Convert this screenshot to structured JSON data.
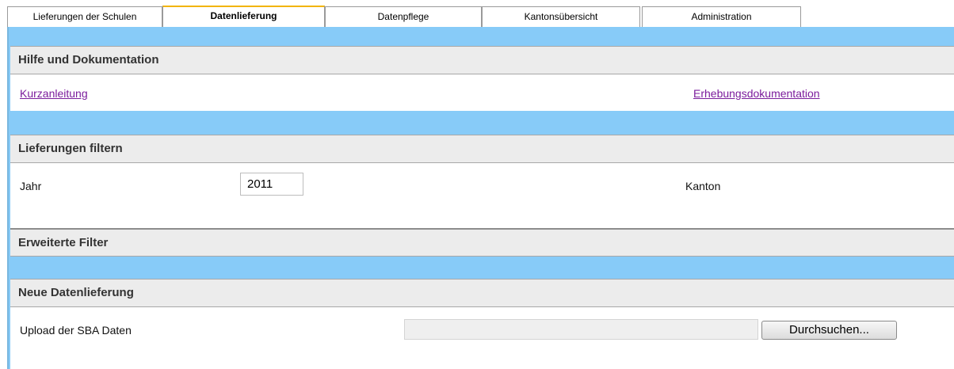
{
  "tabs": [
    {
      "label": "Lieferungen der Schulen",
      "active": false
    },
    {
      "label": "Datenlieferung",
      "active": true
    },
    {
      "label": "Datenpflege",
      "active": false
    },
    {
      "label": "Kantonsübersicht",
      "active": false
    },
    {
      "label": "Administration",
      "active": false
    }
  ],
  "help": {
    "title": "Hilfe und Dokumentation",
    "link_short_guide": "Kurzanleitung",
    "link_survey_docs": "Erhebungsdokumentation"
  },
  "filter": {
    "title": "Lieferungen filtern",
    "year_label": "Jahr",
    "year_value": "2011",
    "canton_label": "Kanton"
  },
  "extended_filter": {
    "title": "Erweiterte Filter"
  },
  "new_delivery": {
    "title": "Neue Datenlieferung",
    "upload_label": "Upload der SBA Daten",
    "browse_label": "Durchsuchen..."
  },
  "colors": {
    "accent_blue": "#87cbf8",
    "active_tab_marker": "#f2b400",
    "link": "#7b1c9c"
  }
}
